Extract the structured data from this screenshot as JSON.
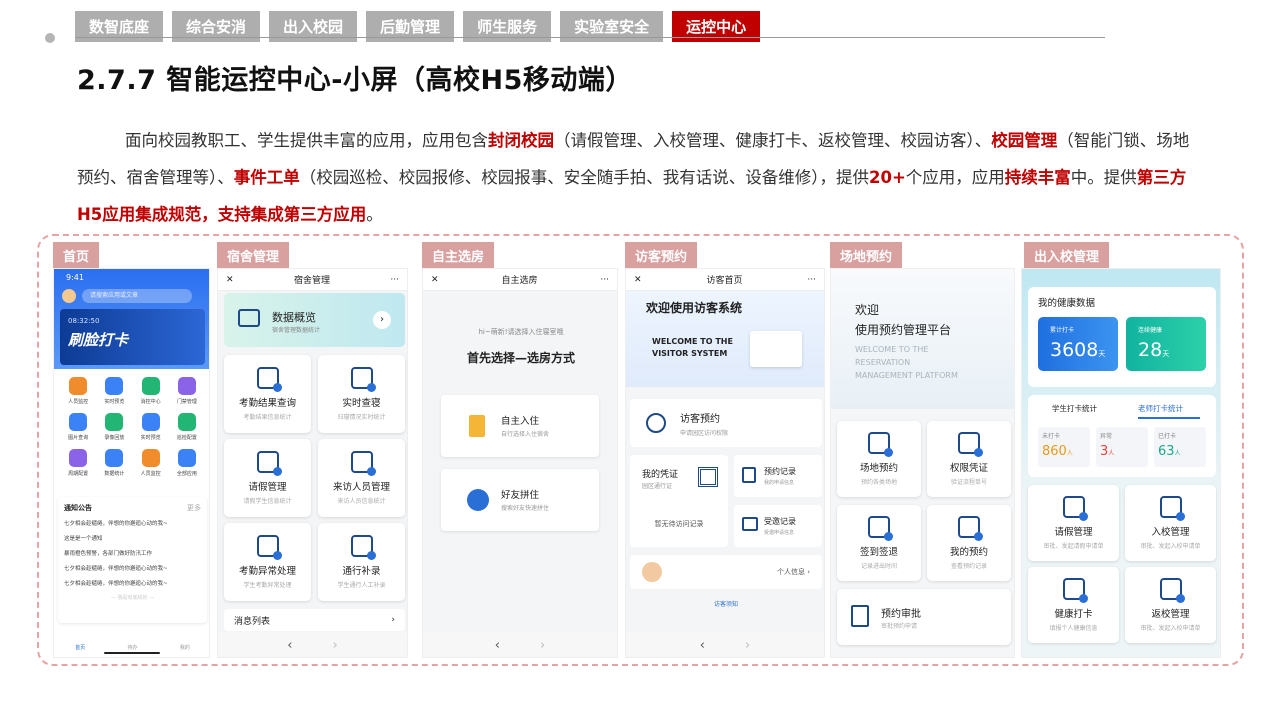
{
  "tabs": [
    "数智底座",
    "综合安消",
    "出入校园",
    "后勤管理",
    "师生服务",
    "实验室安全",
    "运控中心"
  ],
  "title": "2.7.7 智能运控中心-小屏（高校H5移动端）",
  "desc": {
    "p1": "面向校园教职工、学生提供丰富的应用，应用包含",
    "b1": "封闭校园",
    "p2": "（请假管理、入校管理、健康打卡、返校管理、校园访客）、",
    "b2": "校园管理",
    "p3": "（智能门锁、场地预约、宿舍管理等）、",
    "b3": "事件工单",
    "p4": "（校园巡检、校园报修、校园报事、安全随手拍、我有话说、设备维修），提供",
    "b4": "20+",
    "p5": "个应用，应用",
    "b5": "持续丰富",
    "p6": "中。提供",
    "b6": "第三方H5应用集成规范，支持集成第三方应用",
    "p7": "。"
  },
  "labels": [
    "首页",
    "宿舍管理",
    "自主选房",
    "访客预约",
    "场地预约",
    "出入校管理"
  ],
  "home": {
    "time": "9:41",
    "search": "请搜索应用或文章",
    "banner_time": "08:32:50",
    "banner": "刷脸打卡",
    "apps": [
      "人员监控",
      "实时预览",
      "消控中心",
      "门禁管理",
      "图片查询",
      "录像回放",
      "实时预览",
      "巡检配置",
      "周期配置",
      "数据统计",
      "人员监控",
      "全部应用"
    ],
    "notice_title": "通知公告",
    "more": "更多",
    "notices": [
      "七夕相会趁缱绻，伴想的你邂逅心动的我~",
      "这是是一个通知",
      "暴雨橙色预警，各部门做好防汛工作",
      "七夕相会趁缱绻，伴想的你邂逅心动的我~",
      "七夕相会趁缱绻，伴想的你邂逅心动的我~"
    ],
    "end": "— 我是有底线的 —",
    "tabbar": [
      "首页",
      "待办",
      "我的"
    ]
  },
  "dorm": {
    "title": "宿舍管理",
    "overview": "数据概览",
    "overview_sub": "宿舍管理数据统计",
    "cards": [
      [
        "考勤结果查询",
        "考勤结果信息统计"
      ],
      [
        "实时查寝",
        "归寝情况实时统计"
      ],
      [
        "请假管理",
        "请假学生信息统计"
      ],
      [
        "来访人员管理",
        "来访人员信息统计"
      ],
      [
        "考勤异常处理",
        "学生考勤异常处理"
      ],
      [
        "通行补录",
        "学生通行人工补录"
      ]
    ],
    "msg": "消息列表"
  },
  "room": {
    "title": "自主选房",
    "hint": "hi~萌新!请选择入住寝室哦",
    "head": "首先选择—选房方式",
    "opts": [
      [
        "自主入住",
        "自行选择入住宿舍"
      ],
      [
        "好友拼住",
        "搜索好友快速拼住"
      ]
    ]
  },
  "visitor": {
    "title": "访客首页",
    "welcome": "欢迎使用访客系统",
    "en1": "WELCOME TO THE",
    "en2": "VISITOR SYSTEM",
    "book": "访客预约",
    "book_sub": "申请园区访问权限",
    "cert": "我的凭证",
    "cert_sub": "园区通行证",
    "rec": "预约记录",
    "rec_sub": "我的申请信息",
    "none": "暂无待访问记录",
    "recv": "受邀记录",
    "recv_sub": "受邀申请信息",
    "personal": "个人信息",
    "notice": "访客须知"
  },
  "venue": {
    "w1": "欢迎",
    "w2": "使用预约管理平台",
    "en1": "WELCOME TO THE",
    "en2": "RESERVATION",
    "en3": "MANAGEMENT PLATFORM",
    "cards": [
      [
        "场地预约",
        "预约各类场地"
      ],
      [
        "权限凭证",
        "验证流程单号"
      ],
      [
        "签到签退",
        "记录进出时间"
      ],
      [
        "我的预约",
        "查看预约记录"
      ]
    ],
    "audit": "预约审批",
    "audit_sub": "审批预约申请"
  },
  "access": {
    "health": "我的健康数据",
    "c1": "累计打卡",
    "v1": "3608",
    "c2": "连续健康",
    "v2": "28",
    "unit": "天",
    "tab1": "学生打卡统计",
    "tab2": "老师打卡统计",
    "stats": [
      [
        "未打卡",
        "860"
      ],
      [
        "异常",
        "3"
      ],
      [
        "已打卡",
        "63"
      ]
    ],
    "unit2": "人",
    "cards": [
      [
        "请假管理",
        "审批、发起请假申请单"
      ],
      [
        "入校管理",
        "审批、发起入校申请单"
      ],
      [
        "健康打卡",
        "填报个人健康信息"
      ],
      [
        "返校管理",
        "审批、发起入校申请单"
      ]
    ]
  },
  "colors": {
    "accent": "#c00000",
    "tab": "#aeaeae",
    "label": "#d9a0a0",
    "blue": "#2a6fd6"
  }
}
